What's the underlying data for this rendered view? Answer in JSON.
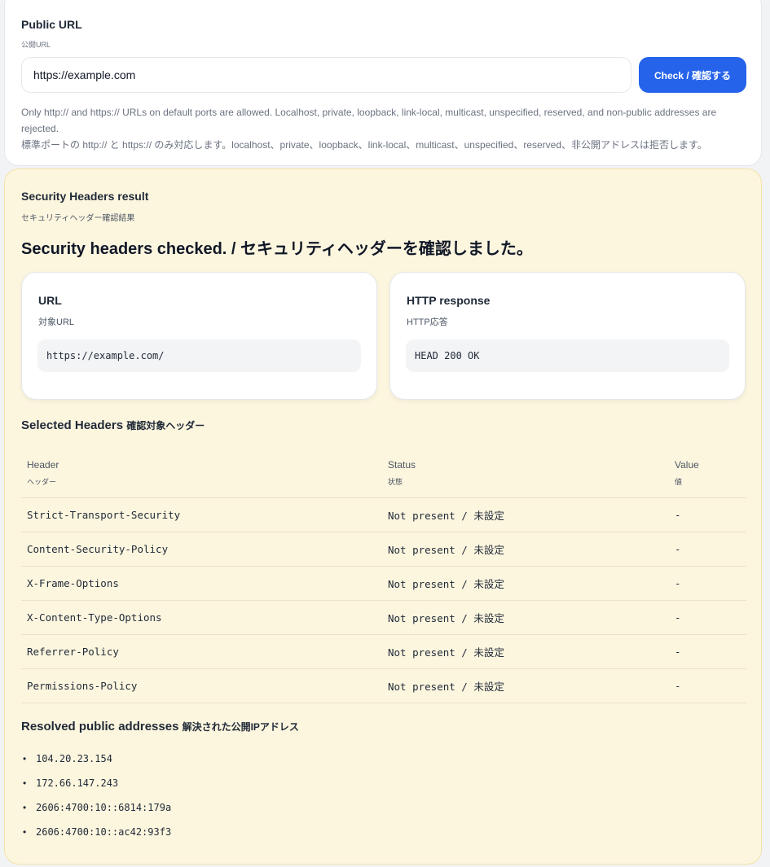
{
  "form": {
    "title": "Public URL",
    "subtitle": "公開URL",
    "url_value": "https://example.com",
    "check_label": "Check / 確認する",
    "hint_en": "Only http:// and https:// URLs on default ports are allowed. Localhost, private, loopback, link-local, multicast, unspecified, reserved, and non-public addresses are rejected.",
    "hint_jp": "標準ポートの http:// と https:// のみ対応します。localhost、private、loopback、link-local、multicast、unspecified、reserved、非公開アドレスは拒否します。"
  },
  "result": {
    "title": "Security Headers result",
    "subtitle": "セキュリティヘッダー確認結果",
    "headline": "Security headers checked. / セキュリティヘッダーを確認しました。",
    "url_card": {
      "title": "URL",
      "subtitle": "対象URL",
      "value": "https://example.com/"
    },
    "http_card": {
      "title": "HTTP response",
      "subtitle": "HTTP応答",
      "value": "HEAD 200 OK"
    },
    "headers_section": {
      "title": "Selected Headers",
      "title_jp": "確認対象ヘッダー"
    },
    "table": {
      "columns": [
        {
          "en": "Header",
          "jp": "ヘッダー"
        },
        {
          "en": "Status",
          "jp": "状態"
        },
        {
          "en": "Value",
          "jp": "値"
        }
      ],
      "rows": [
        {
          "header": "Strict-Transport-Security",
          "status": "Not present / 未設定",
          "value": "-"
        },
        {
          "header": "Content-Security-Policy",
          "status": "Not present / 未設定",
          "value": "-"
        },
        {
          "header": "X-Frame-Options",
          "status": "Not present / 未設定",
          "value": "-"
        },
        {
          "header": "X-Content-Type-Options",
          "status": "Not present / 未設定",
          "value": "-"
        },
        {
          "header": "Referrer-Policy",
          "status": "Not present / 未設定",
          "value": "-"
        },
        {
          "header": "Permissions-Policy",
          "status": "Not present / 未設定",
          "value": "-"
        }
      ]
    },
    "addresses_section": {
      "title": "Resolved public addresses",
      "title_jp": "解決された公開IPアドレス"
    },
    "addresses": [
      "104.20.23.154",
      "172.66.147.243",
      "2606:4700:10::6814:179a",
      "2606:4700:10::ac42:93f3"
    ]
  },
  "colors": {
    "accent": "#2563eb",
    "result_bg": "#fdf6df",
    "page_bg": "#f2f3f5"
  }
}
